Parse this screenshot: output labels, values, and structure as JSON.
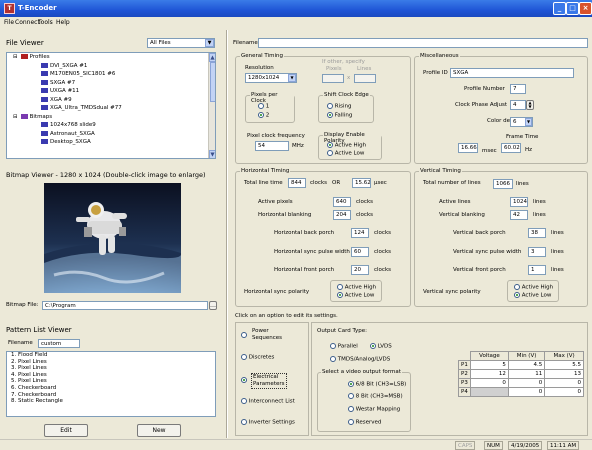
{
  "app": {
    "title": "T-Encoder",
    "icon": "app-icon"
  },
  "menu": [
    "File",
    "Connect",
    "Tools",
    "Help"
  ],
  "file_viewer": {
    "title": "File Viewer",
    "filter": "All Files",
    "tree": [
      {
        "label": "Profiles",
        "level": 0,
        "kind": "folder"
      },
      {
        "label": "DVI_SXGA #1",
        "level": 1,
        "kind": "item"
      },
      {
        "label": "M170EN05_SIC1801 #6",
        "level": 1,
        "kind": "item"
      },
      {
        "label": "SXGA #7",
        "level": 1,
        "kind": "item"
      },
      {
        "label": "UXGA #11",
        "level": 1,
        "kind": "item"
      },
      {
        "label": "XGA #9",
        "level": 1,
        "kind": "item"
      },
      {
        "label": "XGA_Ultra_TMDSdual #77",
        "level": 1,
        "kind": "item"
      },
      {
        "label": "Bitmaps",
        "level": 0,
        "kind": "folder"
      },
      {
        "label": "1024x768 slide9",
        "level": 1,
        "kind": "item"
      },
      {
        "label": "Astronaut_SXGA",
        "level": 1,
        "kind": "item"
      },
      {
        "label": "Desktop_SXGA",
        "level": 1,
        "kind": "item"
      }
    ]
  },
  "bitmap_viewer": {
    "title": "Bitmap Viewer - 1280 x 1024 (Double-click image to enlarge)",
    "file_label": "Bitmap File:",
    "file_value": "C:\\Program"
  },
  "pattern_list": {
    "title": "Pattern List Viewer",
    "filename_label": "Filename",
    "filename_value": "custom",
    "items": [
      "1. Flood Field",
      "2. Pixel Lines",
      "3. Pixel Lines",
      "4. Pixel Lines",
      "5. Pixel Lines",
      "6. Checkerboard",
      "7. Checkerboard",
      "8. Static Rectangle"
    ],
    "edit_label": "Edit",
    "new_label": "New"
  },
  "filename": {
    "label": "Filename",
    "value": ""
  },
  "general_timing": {
    "title": "General Timing",
    "resolution_label": "Resolution",
    "resolution_value": "1280x1024",
    "other_label": "If other, specify",
    "pixels_label": "Pixels",
    "lines_label": "Lines",
    "x_label": "x",
    "ppc_title": "Pixels per Clock",
    "ppc_options": [
      "1",
      "2"
    ],
    "ppc_selected": 1,
    "edge_title": "Shift Clock Edge",
    "edge_options": [
      "Rising",
      "Falling"
    ],
    "edge_selected": 1,
    "pixel_clock_label": "Pixel clock frequency",
    "pixel_clock_value": "54",
    "pixel_clock_unit": "MHz",
    "polarity_title": "Display Enable Polarity",
    "polarity_options": [
      "Active High",
      "Active Low"
    ],
    "polarity_selected": 0
  },
  "misc": {
    "title": "Miscellaneous",
    "profile_id_label": "Profile ID",
    "profile_id_value": "SXGA",
    "profile_number_label": "Profile Number",
    "profile_number_value": "7",
    "clock_phase_label": "Clock Phase Adjust",
    "clock_phase_value": "4",
    "color_depth_label": "Color depth",
    "color_depth_value": "6",
    "frame_time_label": "Frame Time",
    "frame_msec": "16.66",
    "msec_label": "msec",
    "frame_hz": "60.02",
    "hz_label": "Hz"
  },
  "horizontal": {
    "title": "Horizontal Timing",
    "total_label": "Total line time",
    "total_clocks": "844",
    "clocks_label": "clocks",
    "or_label": "OR",
    "total_usec": "15.62",
    "usec_label": "µsec",
    "active_label": "Active pixels",
    "active_value": "640",
    "blank_label": "Horizontal blanking",
    "blank_value": "204",
    "back_label": "Horizontal back porch",
    "back_value": "124",
    "sync_label": "Horizontal sync pulse width",
    "sync_value": "60",
    "front_label": "Horizontal front porch",
    "front_value": "20",
    "polarity_label": "Horizontal sync polarity",
    "polarity_options": [
      "Active High",
      "Active Low"
    ],
    "polarity_selected": 1
  },
  "vertical": {
    "title": "Vertical Timing",
    "total_label": "Total number of lines",
    "total_value": "1066",
    "lines_label": "lines",
    "active_label": "Active lines",
    "active_value": "1024",
    "blank_label": "Vertical blanking",
    "blank_value": "42",
    "back_label": "Vertical back porch",
    "back_value": "38",
    "sync_label": "Vertical sync pulse width",
    "sync_value": "3",
    "front_label": "Vertical front porch",
    "front_value": "1",
    "polarity_label": "Vertical sync polarity",
    "polarity_options": [
      "Active High",
      "Active Low"
    ],
    "polarity_selected": 1
  },
  "options": {
    "hint": "Click on an option to edit its settings.",
    "items": [
      "Power Sequences",
      "Discretes",
      "Electrical Parameters",
      "Interconnect List",
      "Inverter Settings"
    ],
    "selected": 2
  },
  "output_card": {
    "title": "Output Card Type:",
    "types": [
      "Parallel",
      "LVDS",
      "TMDS/Analog/LVDS"
    ],
    "type_selected": 1,
    "format_title": "Select a video output format",
    "formats": [
      "6/8 Bit (CH3=LSB)",
      "8 Bit (CH3=MSB)",
      "Westar Mapping",
      "Reserved"
    ],
    "format_selected": 0
  },
  "voltage_table": {
    "headers": [
      "",
      "Voltage",
      "Min (V)",
      "Max (V)"
    ],
    "rows": [
      [
        "P1",
        "5",
        "4.5",
        "5.5"
      ],
      [
        "P2",
        "12",
        "11",
        "13"
      ],
      [
        "P3",
        "0",
        "0",
        "0"
      ],
      [
        "P4",
        "",
        "0",
        "0"
      ]
    ]
  },
  "status": {
    "caps": "CAPS",
    "num": "NUM",
    "date": "4/19/2005",
    "time": "11:11 AM"
  }
}
